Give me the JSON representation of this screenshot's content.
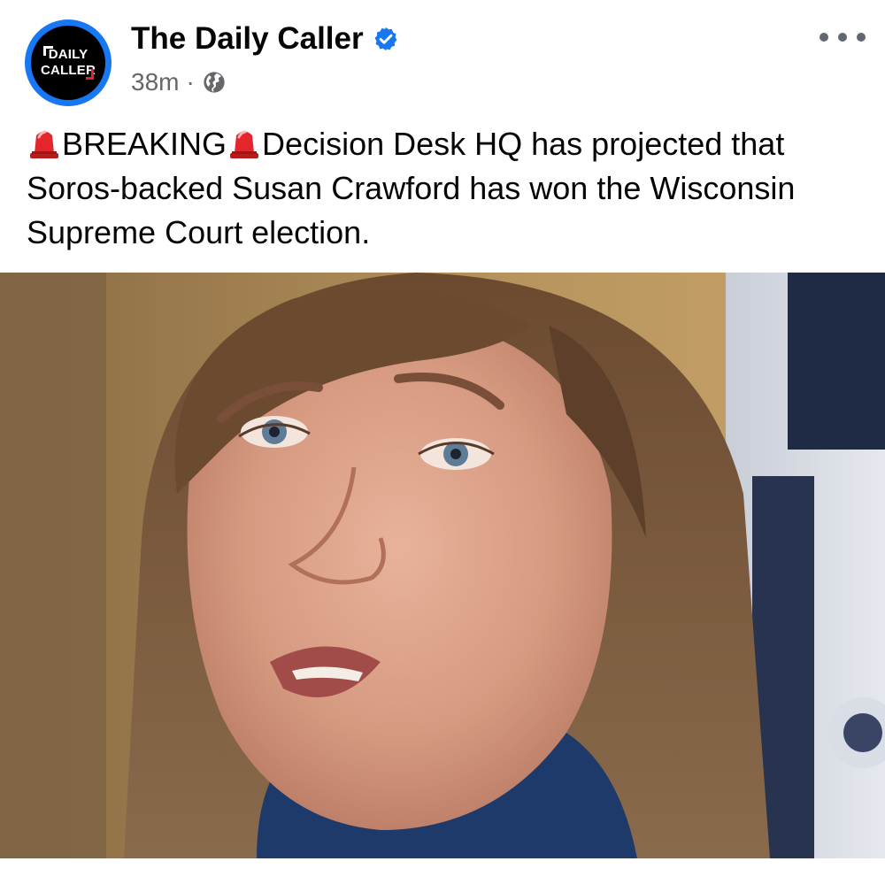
{
  "post": {
    "page_name": "The Daily Caller",
    "avatar_text_line1": "DAILY",
    "avatar_text_line2": "CALLER",
    "timestamp": "38m",
    "separator": "·",
    "audience_icon": "globe-icon",
    "verified_icon": "verified-badge-icon",
    "more_icon": "more-horizontal-icon",
    "text_prefix_emoji": "siren-icon",
    "text_breaking": "BREAKING",
    "text_body": "Decision Desk HQ has projected that Soros-backed Susan Crawford has won the Wisconsin Supreme Court election.",
    "image_icon": "photo"
  },
  "colors": {
    "verified": "#1877f2",
    "meta_text": "#65676b",
    "text": "#050505",
    "siren_red": "#e3252c"
  }
}
